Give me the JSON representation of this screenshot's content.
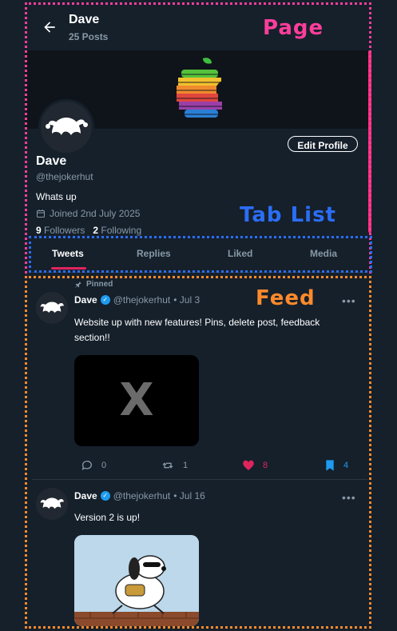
{
  "header": {
    "name": "Dave",
    "posts": "25 Posts"
  },
  "profile": {
    "name": "Dave",
    "handle": "@thejokerhut",
    "bio": "Whats up",
    "joined": "Joined 2nd July 2025",
    "followers_count": "9",
    "followers_label": "Followers",
    "following_count": "2",
    "following_label": "Following",
    "edit_label": "Edit Profile"
  },
  "tabs": [
    {
      "label": "Tweets"
    },
    {
      "label": "Replies"
    },
    {
      "label": "Liked"
    },
    {
      "label": "Media"
    }
  ],
  "annotations": {
    "page": "Page",
    "tablist": "Tab List",
    "feed": "Feed"
  },
  "tweets": [
    {
      "pinned_label": "Pinned",
      "name": "Dave",
      "handle": "@thejokerhut",
      "date": "• Jul 3",
      "text": "Website up with new features! Pins, delete post, feedback section!!",
      "media_label": "X",
      "replies": "0",
      "retweets": "1",
      "likes": "8",
      "bookmarks": "4"
    },
    {
      "name": "Dave",
      "handle": "@thejokerhut",
      "date": "• Jul 16",
      "text": "Version 2 is up!"
    }
  ],
  "colors": {
    "background": "#15202b",
    "accent_like": "#e0245e",
    "accent_blue": "#1d9bf0",
    "page_box": "#ff3e9b",
    "tab_box": "#2b6df5",
    "feed_box": "#ff8a2b"
  }
}
